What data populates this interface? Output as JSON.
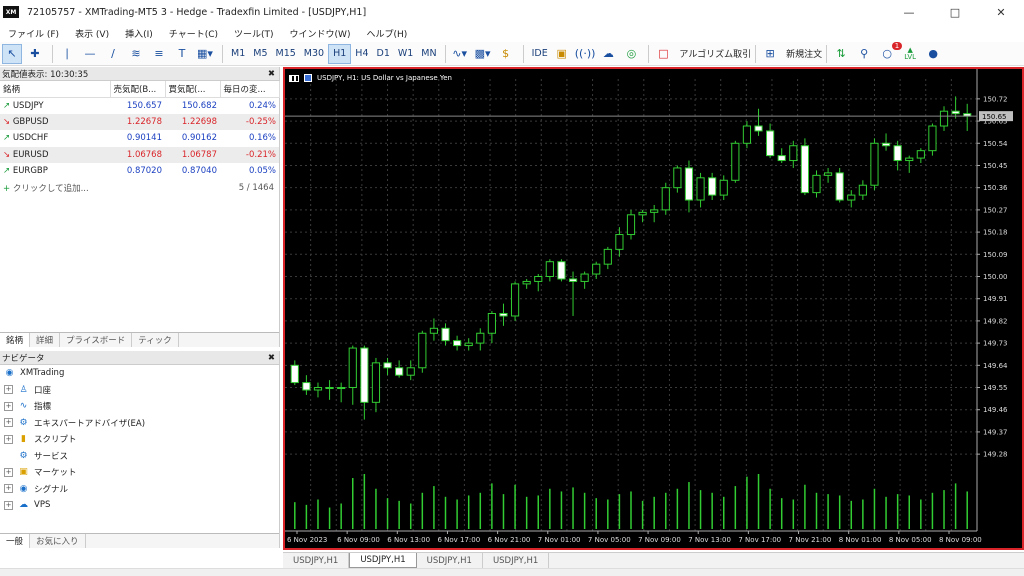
{
  "window": {
    "logo": "XM",
    "title": "72105757 - XMTrading-MT5 3 - Hedge - Tradexfin Limited - [USDJPY,H1]",
    "minimize_icon": "minimize-icon",
    "maximize_icon": "maximize-icon",
    "close_icon": "close-icon"
  },
  "menu": [
    "ファイル (F)",
    "表示 (V)",
    "挿入(I)",
    "チャート(C)",
    "ツール(T)",
    "ウインドウ(W)",
    "ヘルプ(H)"
  ],
  "toolbar": {
    "timeframes": [
      "M1",
      "M5",
      "M15",
      "M30",
      "H1",
      "H4",
      "D1",
      "W1",
      "MN"
    ],
    "active_timeframe": "H1",
    "ide": "IDE",
    "algo_trading": "アルゴリズム取引",
    "new_order": "新規注文",
    "notification_count": "1",
    "lvl": "LVL"
  },
  "market_watch": {
    "title": "気配値表示: 10:30:35",
    "columns": [
      "銘柄",
      "売気配(B...",
      "買気配(...",
      "毎日の変..."
    ],
    "rows": [
      {
        "symbol": "USDJPY",
        "bid": "150.657",
        "ask": "150.682",
        "change": "0.24%",
        "dir": "up"
      },
      {
        "symbol": "GBPUSD",
        "bid": "1.22678",
        "ask": "1.22698",
        "change": "-0.25%",
        "dir": "down"
      },
      {
        "symbol": "USDCHF",
        "bid": "0.90141",
        "ask": "0.90162",
        "change": "0.16%",
        "dir": "up"
      },
      {
        "symbol": "EURUSD",
        "bid": "1.06768",
        "ask": "1.06787",
        "change": "-0.21%",
        "dir": "down"
      },
      {
        "symbol": "EURGBP",
        "bid": "0.87020",
        "ask": "0.87040",
        "change": "0.05%",
        "dir": "up"
      }
    ],
    "add_label": "クリックして追加...",
    "count": "5 / 1464",
    "tabs": [
      "銘柄",
      "詳細",
      "プライスボード",
      "ティック"
    ]
  },
  "navigator": {
    "title": "ナビゲータ",
    "root": "XMTrading",
    "items": [
      {
        "label": "口座",
        "icon": "accounts-icon"
      },
      {
        "label": "指標",
        "icon": "indicators-icon"
      },
      {
        "label": "エキスパートアドバイザ(EA)",
        "icon": "expert-advisor-icon"
      },
      {
        "label": "スクリプト",
        "icon": "script-icon"
      },
      {
        "label": "サービス",
        "icon": "services-icon"
      },
      {
        "label": "マーケット",
        "icon": "market-icon"
      },
      {
        "label": "シグナル",
        "icon": "signals-icon"
      },
      {
        "label": "VPS",
        "icon": "vps-icon"
      }
    ],
    "tabs": [
      "一般",
      "お気に入り"
    ]
  },
  "chart": {
    "header": "USDJPY, H1:  US Dollar vs Japanese Yen",
    "current_price": "150.65",
    "tabs": [
      "USDJPY,H1",
      "USDJPY,H1",
      "USDJPY,H1",
      "USDJPY,H1"
    ],
    "active_tab": 1
  },
  "chart_data": {
    "type": "candlestick",
    "symbol": "USDJPY",
    "timeframe": "H1",
    "ylim": [
      149.24,
      150.76
    ],
    "y_ticks": [
      "150.72",
      "150.63",
      "150.54",
      "150.45",
      "150.36",
      "150.27",
      "150.18",
      "150.09",
      "150.00",
      "149.91",
      "149.82",
      "149.73",
      "149.64",
      "149.55",
      "149.46",
      "149.37",
      "149.28"
    ],
    "x_labels": [
      "6 Nov 2023",
      "6 Nov 09:00",
      "6 Nov 13:00",
      "6 Nov 17:00",
      "6 Nov 21:00",
      "7 Nov 01:00",
      "7 Nov 05:00",
      "7 Nov 09:00",
      "7 Nov 13:00",
      "7 Nov 17:00",
      "7 Nov 21:00",
      "8 Nov 01:00",
      "8 Nov 05:00",
      "8 Nov 09:00"
    ],
    "candles": [
      [
        149.64,
        149.66,
        149.56,
        149.57
      ],
      [
        149.57,
        149.6,
        149.52,
        149.54
      ],
      [
        149.54,
        149.57,
        149.51,
        149.55
      ],
      [
        149.55,
        149.58,
        149.5,
        149.55
      ],
      [
        149.55,
        149.57,
        149.49,
        149.55
      ],
      [
        149.55,
        149.72,
        149.48,
        149.71
      ],
      [
        149.71,
        149.72,
        149.42,
        149.49
      ],
      [
        149.49,
        149.67,
        149.45,
        149.65
      ],
      [
        149.65,
        149.67,
        149.6,
        149.63
      ],
      [
        149.63,
        149.66,
        149.59,
        149.6
      ],
      [
        149.6,
        149.66,
        149.58,
        149.63
      ],
      [
        149.63,
        149.78,
        149.61,
        149.77
      ],
      [
        149.77,
        149.83,
        149.74,
        149.79
      ],
      [
        149.79,
        149.81,
        149.72,
        149.74
      ],
      [
        149.74,
        149.76,
        149.7,
        149.72
      ],
      [
        149.72,
        149.75,
        149.7,
        149.73
      ],
      [
        149.73,
        149.79,
        149.7,
        149.77
      ],
      [
        149.77,
        149.86,
        149.73,
        149.85
      ],
      [
        149.85,
        149.89,
        149.8,
        149.84
      ],
      [
        149.84,
        149.98,
        149.82,
        149.97
      ],
      [
        149.97,
        149.99,
        149.95,
        149.98
      ],
      [
        149.98,
        150.01,
        149.94,
        150.0
      ],
      [
        150.0,
        150.07,
        149.98,
        150.06
      ],
      [
        150.06,
        150.07,
        149.98,
        149.99
      ],
      [
        149.99,
        150.02,
        149.84,
        149.98
      ],
      [
        149.98,
        150.02,
        149.95,
        150.01
      ],
      [
        150.01,
        150.06,
        149.99,
        150.05
      ],
      [
        150.05,
        150.12,
        150.03,
        150.11
      ],
      [
        150.11,
        150.2,
        150.08,
        150.17
      ],
      [
        150.17,
        150.27,
        150.15,
        150.25
      ],
      [
        150.25,
        150.27,
        150.22,
        150.26
      ],
      [
        150.26,
        150.29,
        150.22,
        150.27
      ],
      [
        150.27,
        150.38,
        150.25,
        150.36
      ],
      [
        150.36,
        150.45,
        150.34,
        150.44
      ],
      [
        150.44,
        150.47,
        150.26,
        150.31
      ],
      [
        150.31,
        150.42,
        150.28,
        150.4
      ],
      [
        150.4,
        150.42,
        150.31,
        150.33
      ],
      [
        150.33,
        150.41,
        150.31,
        150.39
      ],
      [
        150.39,
        150.55,
        150.38,
        150.54
      ],
      [
        150.54,
        150.63,
        150.52,
        150.61
      ],
      [
        150.61,
        150.68,
        150.57,
        150.59
      ],
      [
        150.59,
        150.62,
        150.48,
        150.49
      ],
      [
        150.49,
        150.52,
        150.46,
        150.47
      ],
      [
        150.47,
        150.55,
        150.44,
        150.53
      ],
      [
        150.53,
        150.56,
        150.33,
        150.34
      ],
      [
        150.34,
        150.43,
        150.32,
        150.41
      ],
      [
        150.41,
        150.44,
        150.38,
        150.42
      ],
      [
        150.42,
        150.44,
        150.3,
        150.31
      ],
      [
        150.31,
        150.35,
        150.28,
        150.33
      ],
      [
        150.33,
        150.39,
        150.31,
        150.37
      ],
      [
        150.37,
        150.56,
        150.35,
        150.54
      ],
      [
        150.54,
        150.58,
        150.51,
        150.53
      ],
      [
        150.53,
        150.55,
        150.43,
        150.47
      ],
      [
        150.47,
        150.49,
        150.42,
        150.48
      ],
      [
        150.48,
        150.52,
        150.46,
        150.51
      ],
      [
        150.51,
        150.62,
        150.49,
        150.61
      ],
      [
        150.61,
        150.69,
        150.59,
        150.67
      ],
      [
        150.67,
        150.73,
        150.64,
        150.66
      ],
      [
        150.66,
        150.7,
        150.59,
        150.65
      ]
    ],
    "volumes": [
      20,
      18,
      22,
      16,
      19,
      38,
      41,
      30,
      23,
      21,
      19,
      27,
      32,
      24,
      22,
      25,
      27,
      34,
      26,
      33,
      24,
      25,
      30,
      28,
      31,
      27,
      23,
      22,
      26,
      28,
      21,
      24,
      27,
      30,
      35,
      29,
      27,
      24,
      32,
      39,
      41,
      30,
      23,
      22,
      33,
      27,
      26,
      25,
      21,
      22,
      30,
      24,
      26,
      25,
      22,
      27,
      29,
      34,
      28
    ]
  }
}
